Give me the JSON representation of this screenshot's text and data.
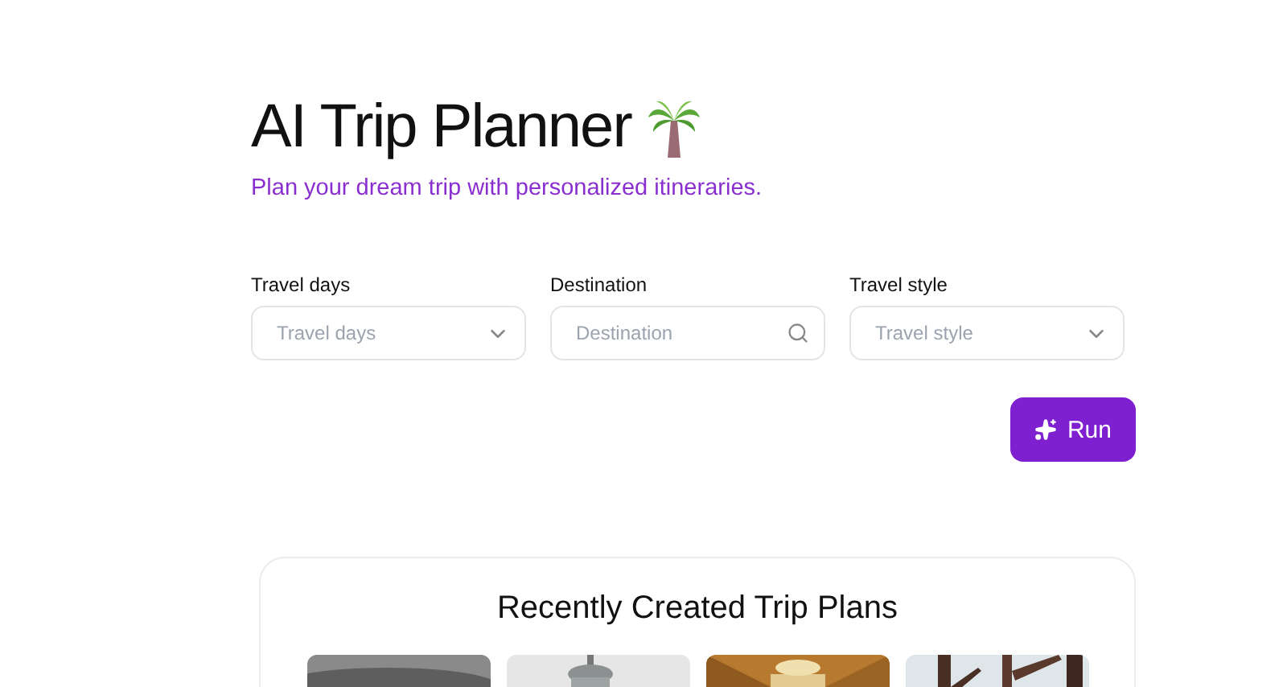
{
  "header": {
    "title": "AI Trip Planner",
    "subtitle": "Plan your dream trip with personalized itineraries."
  },
  "fields": [
    {
      "label": "Travel days",
      "placeholder": "Travel days",
      "kind": "select"
    },
    {
      "label": "Destination",
      "placeholder": "Destination",
      "kind": "search"
    },
    {
      "label": "Travel style",
      "placeholder": "Travel style",
      "kind": "select"
    }
  ],
  "run_button": {
    "label": "Run"
  },
  "recent": {
    "title": "Recently Created Trip Plans"
  }
}
